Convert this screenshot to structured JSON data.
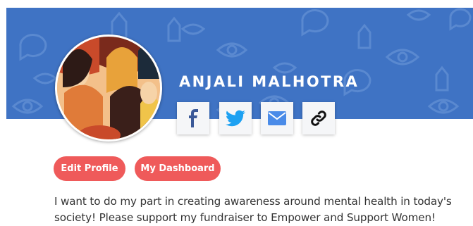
{
  "profile": {
    "name": "ANJALI MALHOTRA",
    "bio": "I want to do my part in creating awareness around mental health in today's society! Please support my fundraiser to Empower and Support Women!"
  },
  "social": [
    {
      "icon": "facebook-icon",
      "color": "#3b5998"
    },
    {
      "icon": "twitter-icon",
      "color": "#1da1f2"
    },
    {
      "icon": "mail-icon",
      "color": "#4a8be8"
    },
    {
      "icon": "link-icon",
      "color": "#111111"
    }
  ],
  "actions": {
    "edit_profile": "Edit Profile",
    "my_dashboard": "My Dashboard"
  },
  "colors": {
    "banner": "#3f73c4",
    "accent": "#ef5a5a"
  }
}
